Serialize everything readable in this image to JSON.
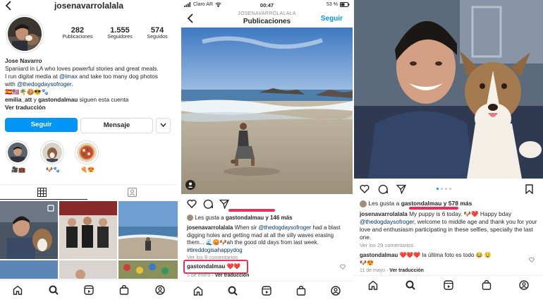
{
  "profile": {
    "username": "josenavarrolalala",
    "stats": [
      {
        "value": "282",
        "label": "Publicaciones"
      },
      {
        "value": "1.555",
        "label": "Seguidores"
      },
      {
        "value": "574",
        "label": "Seguidos"
      }
    ],
    "name": "Jose Navarro",
    "bio_1": "Spaniard in LA who loves powerful stories and great meals.",
    "bio_2a": "I run digital media at",
    "bio_2b": "@imax",
    "bio_2c": "and take too many dog photos",
    "bio_3a": "with",
    "bio_3b": "@thedogdaysofroger",
    "bio_3c": ".",
    "emojis": "🇪🇸🇺🇸🌴🍪😎🐾",
    "followed_by_1": "emilia_att",
    "followed_by_and": "y",
    "followed_by_2": "gastondalmau",
    "followed_by_tail": "siguen esta cuenta",
    "translate": "Ver traducción",
    "follow_button": "Seguir",
    "message_button": "Mensaje",
    "highlights": [
      {
        "label": "🎥💼"
      },
      {
        "label": "🐶🐾"
      },
      {
        "label": "🍕😍"
      }
    ]
  },
  "feed": {
    "header_user": "JOSENAVARROLALALA",
    "header_title": "Publicaciones",
    "follow_link": "Seguir",
    "status": {
      "carrier": "Claro AR",
      "time": "00:47",
      "battery": "53 %"
    },
    "likes_prefix": "Les gusta a",
    "likes_user": "gastondalmau",
    "likes_suffix": "y 146 más",
    "caption_user": "josenavarrolalala",
    "caption_a": "When sir",
    "caption_mention": "@thedogdaysofroger",
    "caption_b": "had a blast digging holes and getting mad at all the silly waves erasing them... 🌊😡🐶ah the good old days from last week.",
    "caption_tag": "#tireddogisahappydog",
    "view_comments": "Ver los 8 comentarios",
    "comment_user": "gastondalmau",
    "comment_text": "❤️❤️",
    "date": "5 de enero",
    "translate": "Ver traducción"
  },
  "post": {
    "likes_prefix": "Les gusta a",
    "likes_user": "gastondalmau",
    "likes_suffix": "y 578 más",
    "caption_user": "josenavarrolalala",
    "caption_a": "My puppy is 6 today. 🐶❤️ Happy bday",
    "caption_mention": "@thedogdaysofroger",
    "caption_b": ", welcome to middle age and thank you for your love and enthusiasm participating in these selfies, specially the last one.",
    "view_comments": "Ver los 29 comentarios",
    "comment_user": "gastondalmau",
    "comment_text": "❤️❤️❤️ la última foto es todo 😂 🤤",
    "comment2": "🐶😍",
    "date": "11 de mayo",
    "translate": "Ver traducción"
  },
  "colors": {
    "accent": "#0095f6",
    "underline": "#e8305a",
    "link": "#00376b"
  }
}
